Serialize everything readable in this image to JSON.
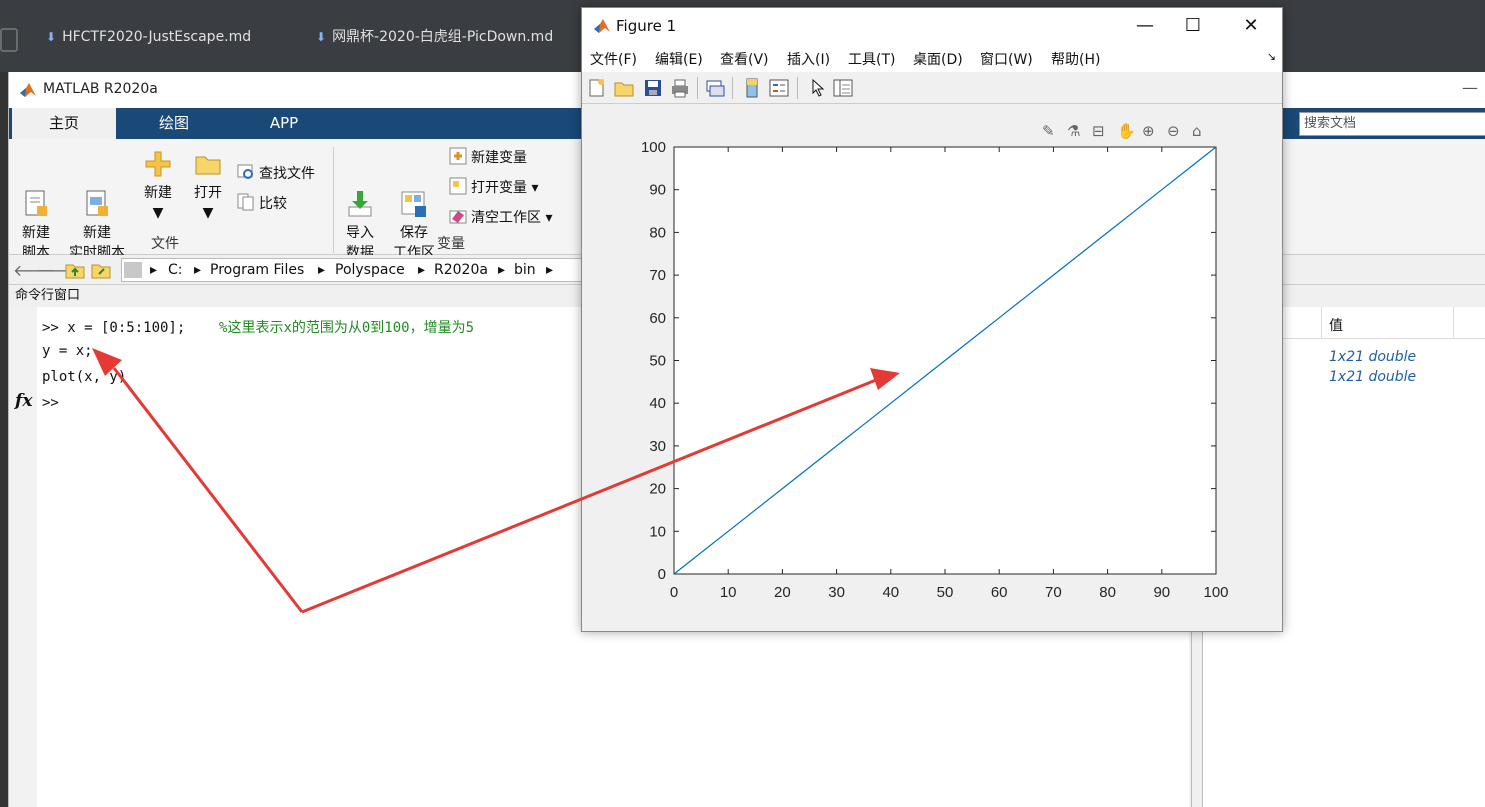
{
  "background_editor": {
    "tabs": [
      "HFCTF2020-JustEscape.md",
      "网鼎杯-2020-白虎组-PicDown.md"
    ]
  },
  "matlab": {
    "title": "MATLAB R2020a",
    "tabs": [
      {
        "label": "主页",
        "active": true
      },
      {
        "label": "绘图",
        "active": false
      },
      {
        "label": "APP",
        "active": false
      }
    ],
    "search_placeholder": "搜索文档",
    "ribbon": {
      "new_script": "新建\n脚本",
      "new_live_script": "新建\n实时脚本",
      "new": "新建",
      "open": "打开",
      "find_files": "查找文件",
      "compare": "比较",
      "import_data": "导入\n数据",
      "save_workspace": "保存\n工作区",
      "new_variable": "新建变量",
      "open_variable": "打开变量",
      "clear_workspace": "清空工作区",
      "group_file": "文件",
      "group_variable": "变量"
    },
    "path": [
      "C:",
      "Program Files",
      "Polyspace",
      "R2020a",
      "bin"
    ],
    "command_window": {
      "header": "命令行窗口",
      "lines": [
        {
          "text": ">> x = [0:5:100];",
          "comment": "%这里表示x的范围为从0到100，增量为5"
        },
        {
          "text": "y = x;",
          "comment": ""
        },
        {
          "text": "plot(x, y)",
          "comment": ""
        }
      ],
      "prompt": ">>",
      "fx_label": "fx"
    },
    "workspace": {
      "value_header": "值",
      "values": [
        "1x21 double",
        "1x21 double"
      ]
    }
  },
  "figure": {
    "title": "Figure 1",
    "menu": [
      "文件(F)",
      "编辑(E)",
      "查看(V)",
      "插入(I)",
      "工具(T)",
      "桌面(D)",
      "窗口(W)",
      "帮助(H)"
    ],
    "window_controls": {
      "minimize": "—",
      "maximize": "☐",
      "close": "✕"
    },
    "line_color": "#0072BD"
  },
  "chart_data": {
    "type": "line",
    "x": [
      0,
      5,
      10,
      15,
      20,
      25,
      30,
      35,
      40,
      45,
      50,
      55,
      60,
      65,
      70,
      75,
      80,
      85,
      90,
      95,
      100
    ],
    "series": [
      {
        "values": [
          0,
          5,
          10,
          15,
          20,
          25,
          30,
          35,
          40,
          45,
          50,
          55,
          60,
          65,
          70,
          75,
          80,
          85,
          90,
          95,
          100
        ]
      }
    ],
    "xlim": [
      0,
      100
    ],
    "ylim": [
      0,
      100
    ],
    "xticks": [
      "0",
      "10",
      "20",
      "30",
      "40",
      "50",
      "60",
      "70",
      "80",
      "90",
      "100"
    ],
    "yticks": [
      "0",
      "10",
      "20",
      "30",
      "40",
      "50",
      "60",
      "70",
      "80",
      "90",
      "100"
    ],
    "grid": false
  },
  "annotation_color": "#e53935"
}
